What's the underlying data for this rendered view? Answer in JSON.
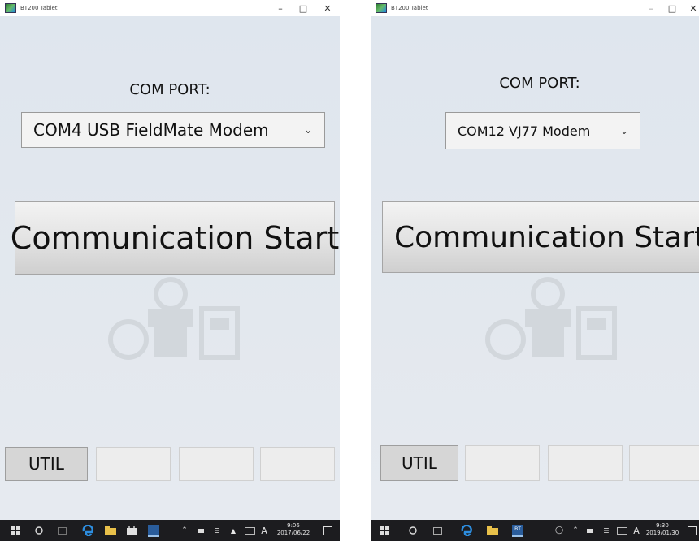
{
  "left": {
    "window_title": "BT200 Tablet",
    "com_port_label": "COM PORT:",
    "com_port_value": "COM4 USB FieldMate Modem",
    "comm_button": "Communication Start",
    "util_button": "UTIL",
    "clock_time": "9:06",
    "clock_date": "2017/06/22",
    "lang": "A"
  },
  "right": {
    "window_title": "BT200 Tablet",
    "com_port_label": "COM PORT:",
    "com_port_value": "COM12 VJ77 Modem",
    "comm_button": "Communication Start",
    "util_button": "UTIL",
    "clock_time": "9:30",
    "clock_date": "2019/01/30",
    "lang": "A",
    "bt_badge": "BT"
  },
  "icons": {
    "dropdown": "chevron-down-icon",
    "windows": "windows-start-icon",
    "search": "search-circle-icon",
    "taskview": "task-view-icon",
    "edge": "edge-icon",
    "explorer": "folder-icon",
    "store": "store-icon",
    "app": "bt200-app-icon"
  },
  "colors": {
    "background": "#dfe5ec",
    "taskbar": "#1c1c1f",
    "edge_blue": "#2d8ee0",
    "folder_yellow": "#e8c04a"
  }
}
